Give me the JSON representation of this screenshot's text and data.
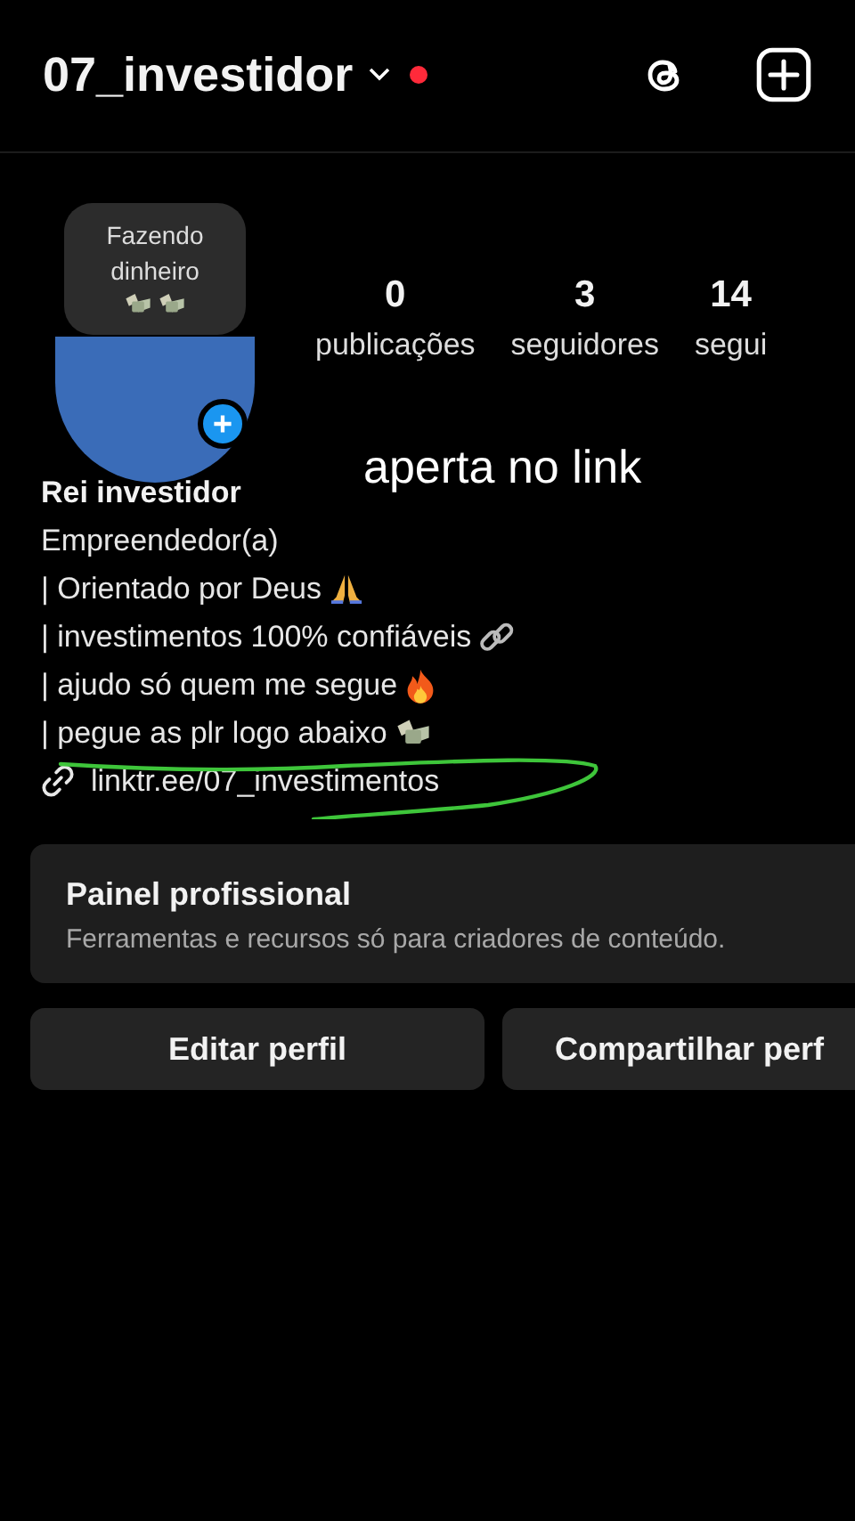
{
  "header": {
    "username": "07_investidor",
    "has_notification": true
  },
  "profile": {
    "note": "Fazendo dinheiro",
    "note_icons": [
      {
        "kind": "money"
      },
      {
        "kind": "money"
      }
    ],
    "display_name": "Rei investidor",
    "category": "Empreendedor(a)"
  },
  "stats": [
    {
      "value": "0",
      "label": "publicações"
    },
    {
      "value": "3",
      "label": "seguidores"
    },
    {
      "value": "14",
      "label": "segui"
    }
  ],
  "overlay_text": "aperta no link",
  "bio": [
    {
      "text": "| Orientado por Deus",
      "kind": "pray"
    },
    {
      "text": "| investimentos 100% confiáveis",
      "kind": "link"
    },
    {
      "text": "| ajudo só quem me segue",
      "kind": "fire"
    },
    {
      "text": "| pegue as plr logo abaixo",
      "kind": "money"
    }
  ],
  "link": "linktr.ee/07_investimentos",
  "dashboard": {
    "title": "Painel profissional",
    "subtitle": "Ferramentas e recursos só para criadores de conteúdo."
  },
  "buttons": [
    "Editar perfil",
    "Compartilhar perf"
  ]
}
